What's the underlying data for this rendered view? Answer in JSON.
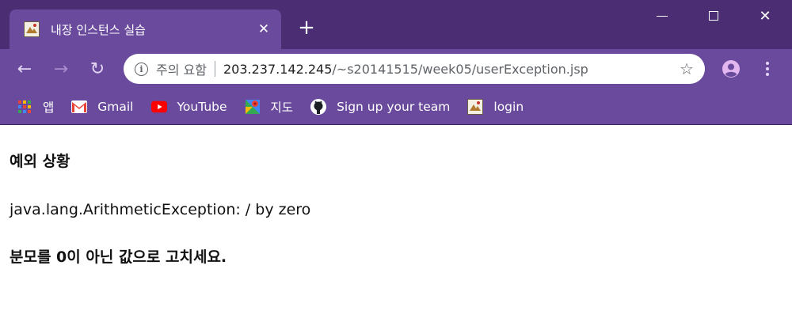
{
  "window": {
    "tab_title": "내장 인스턴스 실습",
    "tab_close_glyph": "✕",
    "new_tab_glyph": "+",
    "close_glyph": "✕"
  },
  "toolbar": {
    "back_glyph": "←",
    "forward_glyph": "→",
    "reload_glyph": "↻",
    "security_label": "주의 요함",
    "url_host": "203.237.142.245",
    "url_path": "/~s20141515/week05/userException.jsp",
    "star_glyph": "☆"
  },
  "bookmarks": [
    {
      "label": "앱",
      "icon": "apps-grid-icon"
    },
    {
      "label": "Gmail",
      "icon": "gmail-icon"
    },
    {
      "label": "YouTube",
      "icon": "youtube-icon"
    },
    {
      "label": "지도",
      "icon": "maps-icon"
    },
    {
      "label": "Sign up your team",
      "icon": "github-icon"
    },
    {
      "label": "login",
      "icon": "site-favicon-icon"
    }
  ],
  "page": {
    "heading": "예외 상황",
    "exception_text": "java.lang.ArithmeticException: / by zero",
    "instruction": "분모를 0이 아닌 값으로 고치세요."
  },
  "colors": {
    "titlebar": "#4b2d74",
    "toolbar": "#6a4a9c",
    "page_bg": "#ffffff",
    "text": "#111111"
  }
}
